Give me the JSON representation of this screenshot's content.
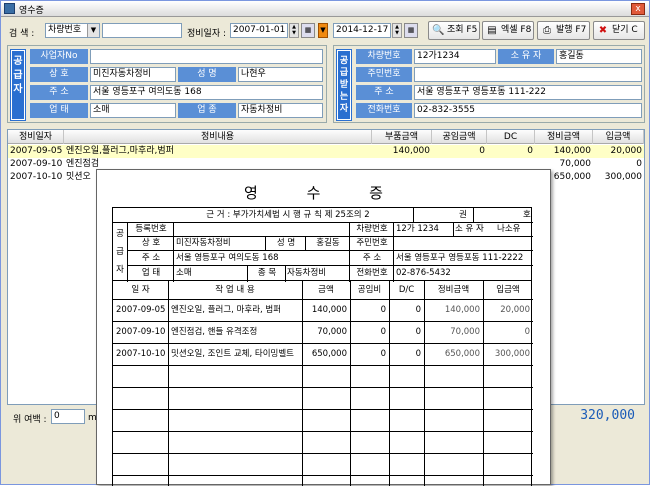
{
  "window": {
    "title": "영수증",
    "close": "x"
  },
  "search": {
    "label": "검 색 :",
    "field_value": "차량번호",
    "date_label": "정비일자 :",
    "date_from": "2007-01-01",
    "date_to": "2014-12-17"
  },
  "toolbar": {
    "query": "조회 F5",
    "excel": "엑셀 F8",
    "print": "발행 F7",
    "close": "닫기 C"
  },
  "supplier": {
    "vlabel": "공급자",
    "reg_no_label": "사업자No",
    "reg_no": "",
    "company_label": "상 호",
    "company": "미진자동차정비",
    "name_label": "성 명",
    "name": "나현우",
    "address_label": "주 소",
    "address": "서울 영등포구 여의도동 168",
    "business_label": "업 태",
    "business": "소매",
    "item_label": "업 종",
    "item": "자동차정비"
  },
  "receiver": {
    "vlabel": "공급받는자",
    "car_no_label": "차량번호",
    "car_no": "12가1234",
    "owner_label": "소 유 자",
    "owner": "홍길동",
    "resident_label": "주민번호",
    "resident": "",
    "address_label": "주 소",
    "address": "서울 영등포구 영등포동 111-222",
    "phone_label": "전화번호",
    "phone": "02-832-3555"
  },
  "grid": {
    "headers": [
      "정비일자",
      "정비내용",
      "부품금액",
      "공임금액",
      "DC",
      "정비금액",
      "입금액"
    ],
    "rows": [
      [
        "2007-09-05",
        "엔진오일,플러그,마후라,범퍼",
        "140,000",
        "0",
        "0",
        "140,000",
        "20,000"
      ],
      [
        "2007-09-10",
        "엔진점검",
        "",
        "",
        "",
        "70,000",
        "0"
      ],
      [
        "2007-10-10",
        "밋션오",
        "",
        "",
        "",
        "650,000",
        "300,000"
      ]
    ]
  },
  "bottom": {
    "margin_label": "위 여백 :",
    "margin_value": "0",
    "margin_unit": "m",
    "total": "320,000"
  },
  "receipt": {
    "title": "영 수 증",
    "legal_basis": "근 거 : 부가가치세법 시 행 규 칙 제 25조의 2",
    "book_label": "권",
    "no_label": "호",
    "supplier_vlabel": "공급자",
    "reg_no_label": "등록번호",
    "company_label": "상 호",
    "company": "미진자동차정비",
    "name_label": "성 명",
    "name": "홍길동",
    "address_label": "주 소",
    "address": "서울 영등포구 여의도동 168",
    "business_label": "업 태",
    "business": "소매",
    "item_label": "종 목",
    "item": "자동차정비",
    "car_no_label": "차량번호",
    "car_no": "12가 1234",
    "owner_label": "소 유 자",
    "owner": "나소유",
    "resident_label": "주민번호",
    "addr2_label": "주 소",
    "addr2": "서울 영등포구 영등포동 111-2222",
    "phone_label": "전화번호",
    "phone": "02-876-5432",
    "item_headers": [
      "일 자",
      "작 업 내 용",
      "금액",
      "공임비",
      "D/C",
      "정비금액",
      "입금액"
    ],
    "items": [
      [
        "2007-09-05",
        "엔진오일, 플러그, 마후라, 범퍼",
        "140,000",
        "0",
        "0",
        "140,000",
        "20,000"
      ],
      [
        "2007-09-10",
        "엔진점검, 핸들 유격조정",
        "70,000",
        "0",
        "0",
        "70,000",
        "0"
      ],
      [
        "2007-10-10",
        "밋션오일, 조인트 교체, 타이밍벨트",
        "650,000",
        "0",
        "0",
        "650,000",
        "300,000"
      ]
    ]
  }
}
